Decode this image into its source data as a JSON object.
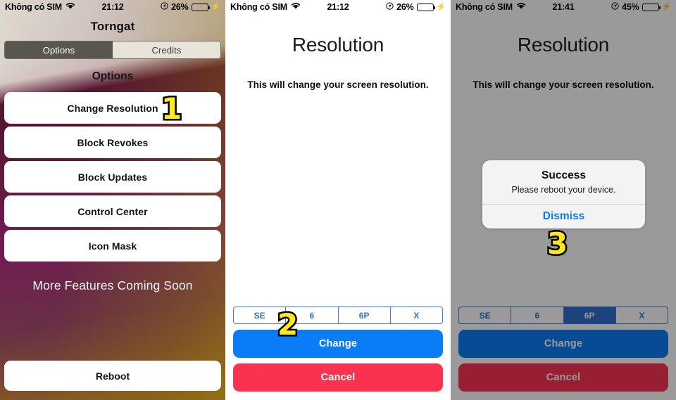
{
  "panels": [
    {
      "name": "torngat-options",
      "statusbar": {
        "carrier": "Không có SIM",
        "wifi_icon": "wifi-icon",
        "time": "21:12",
        "location_icon": "location-arrow-icon",
        "battery_percent": "26%",
        "battery_fill": 26,
        "charging_icon": "lightning-bolt-icon"
      },
      "title": "Torngat",
      "segmented": {
        "options": [
          {
            "label": "Options",
            "selected": true
          },
          {
            "label": "Credits",
            "selected": false
          }
        ]
      },
      "section_header": "Options",
      "options": [
        {
          "label": "Change Resolution"
        },
        {
          "label": "Block Revokes"
        },
        {
          "label": "Block Updates"
        },
        {
          "label": "Control Center"
        },
        {
          "label": "Icon Mask"
        }
      ],
      "more_features": "More Features Coming Soon",
      "reboot_label": "Reboot"
    },
    {
      "name": "resolution-picker",
      "statusbar": {
        "carrier": "Không có SIM",
        "wifi_icon": "wifi-icon",
        "time": "21:12",
        "location_icon": "location-arrow-icon",
        "battery_percent": "26%",
        "battery_fill": 26,
        "charging_icon": "lightning-bolt-icon"
      },
      "title": "Resolution",
      "subtitle": "This will change your screen resolution.",
      "resolution_options": [
        {
          "label": "SE",
          "selected": false
        },
        {
          "label": "6",
          "selected": false
        },
        {
          "label": "6P",
          "selected": false
        },
        {
          "label": "X",
          "selected": false
        }
      ],
      "change_label": "Change",
      "cancel_label": "Cancel"
    },
    {
      "name": "resolution-success",
      "statusbar": {
        "carrier": "Không có SIM",
        "wifi_icon": "wifi-icon",
        "time": "21:41",
        "location_icon": "location-arrow-icon",
        "battery_percent": "45%",
        "battery_fill": 45,
        "charging_icon": "lightning-bolt-icon"
      },
      "title": "Resolution",
      "subtitle": "This will change your screen resolution.",
      "resolution_options": [
        {
          "label": "SE",
          "selected": false
        },
        {
          "label": "6",
          "selected": false
        },
        {
          "label": "6P",
          "selected": true
        },
        {
          "label": "X",
          "selected": false
        }
      ],
      "change_label": "Change",
      "cancel_label": "Cancel",
      "alert": {
        "title": "Success",
        "message": "Please reboot your device.",
        "action_label": "Dismiss"
      }
    }
  ],
  "step_badges": [
    {
      "label": "1"
    },
    {
      "label": "2"
    },
    {
      "label": "3"
    }
  ],
  "colors": {
    "accent_blue": "#0a7cf7",
    "segment_blue": "#2f6fd0",
    "cancel_red": "#fa3250",
    "battery_green": "#4cd964",
    "badge_yellow": "#ffe81a",
    "segment_dark": "#58564f"
  }
}
